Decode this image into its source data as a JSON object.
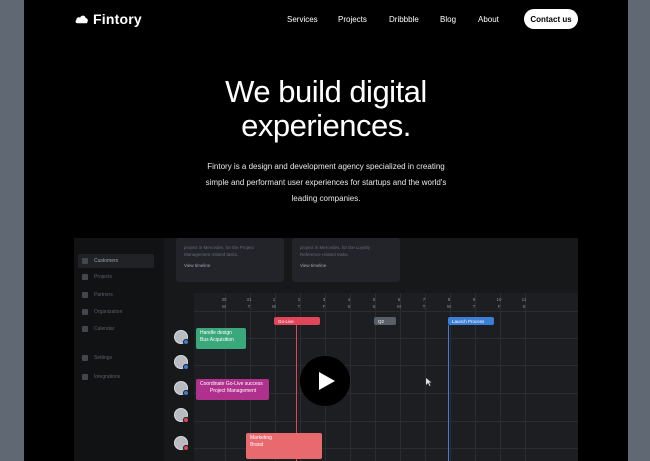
{
  "nav": {
    "brand": "Fintory",
    "links": [
      "Services",
      "Projects",
      "Dribbble",
      "Blog",
      "About"
    ],
    "contact_label": "Contact us"
  },
  "hero": {
    "title_line1": "We build digital",
    "title_line2": "experiences.",
    "subtitle_line1": "Fintory is a design and development agency specialized in creating",
    "subtitle_line2": "simple and performant user experiences for startups and the world's",
    "subtitle_line3": "leading companies."
  },
  "video": {
    "sidebar_items": [
      "Customers",
      "Projects",
      "Partners",
      "Organization",
      "Calendar",
      "Settings",
      "Integrations"
    ],
    "cards": [
      {
        "line1": "project in Mercedes, for the Project",
        "line2": "Management related tasks.",
        "button": "View timeline"
      },
      {
        "line1": "project in Mercedes, for the Loyalty",
        "line2": "Reference related tasks.",
        "button": "View timeline"
      }
    ],
    "days": [
      {
        "num": "30",
        "dow": "M"
      },
      {
        "num": "31",
        "dow": "T"
      },
      {
        "num": "1",
        "dow": "W"
      },
      {
        "num": "2",
        "dow": "T"
      },
      {
        "num": "3",
        "dow": "F"
      },
      {
        "num": "4",
        "dow": "S"
      },
      {
        "num": "5",
        "dow": "S"
      },
      {
        "num": "6",
        "dow": "M"
      },
      {
        "num": "7",
        "dow": "T"
      },
      {
        "num": "8",
        "dow": "W"
      },
      {
        "num": "9",
        "dow": "T"
      },
      {
        "num": "10",
        "dow": "F"
      },
      {
        "num": "11",
        "dow": "S"
      }
    ],
    "markers": [
      {
        "label": "Go-Live",
        "color": "#e0455a"
      },
      {
        "label": "Q2",
        "color": "#5a5e66"
      },
      {
        "label": "Launch Process",
        "color": "#3d7fd6"
      }
    ],
    "tasks": [
      {
        "line1": "Handle design",
        "line2": "Bus Acquisition",
        "color": "#3aa87a"
      },
      {
        "line1": "Coordinate Go-Live success",
        "line2": "Project Management",
        "color": "#b0308e"
      },
      {
        "line1": "Marketing",
        "line2": "Brand",
        "color": "#e86a6e"
      }
    ],
    "avatar_badges": [
      "#3d7fd6",
      "#3d7fd6",
      "#3d7fd6",
      "#e0455a",
      "#e0455a"
    ]
  },
  "colors": {
    "background": "#000000",
    "accent_blue": "#3d7fd6",
    "accent_red": "#e0455a"
  }
}
